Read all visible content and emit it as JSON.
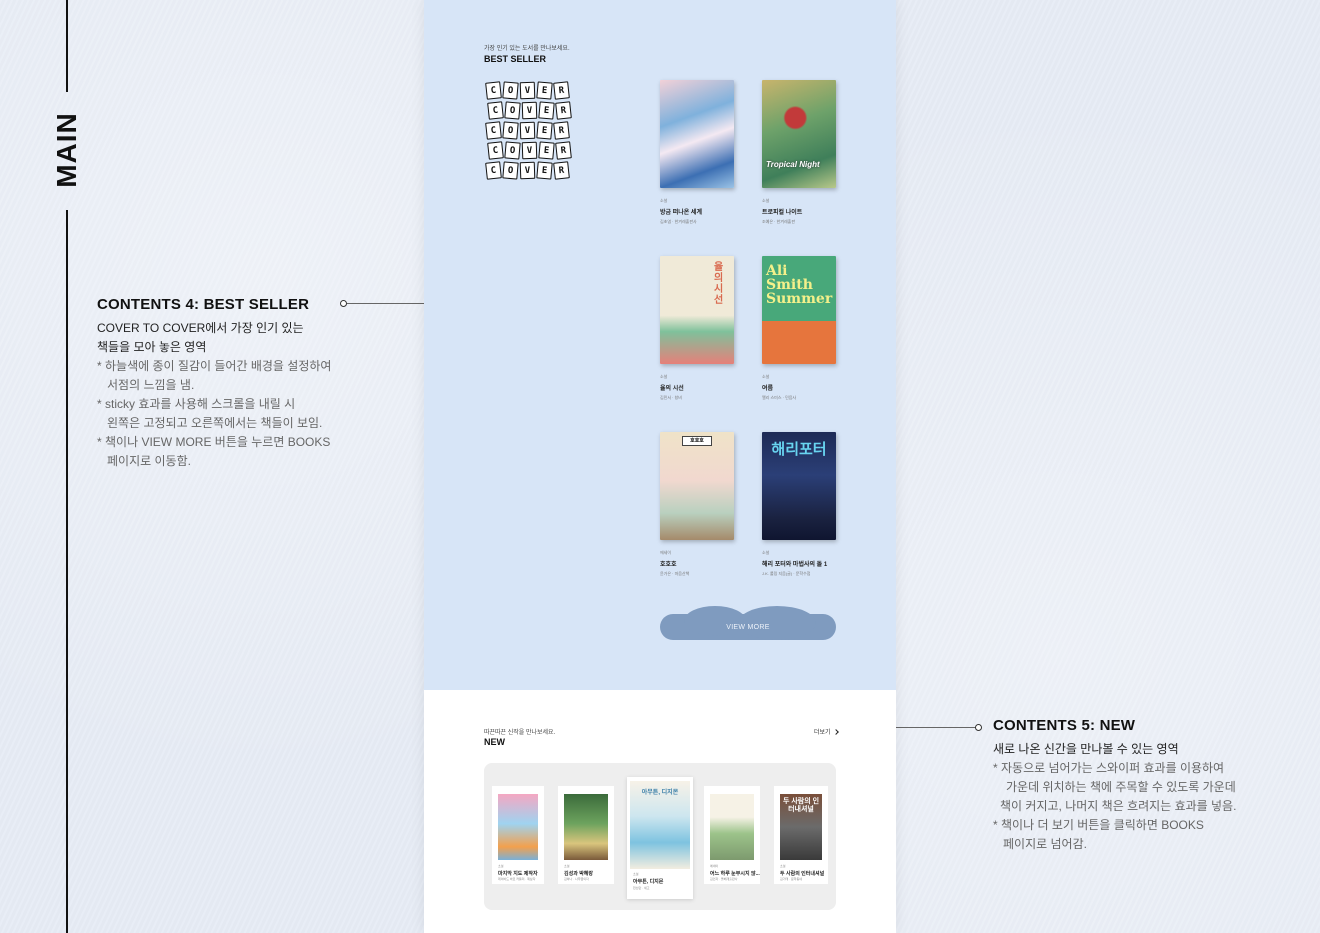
{
  "side_label": "MAIN",
  "annotation_best": {
    "title": "CONTENTS 4:  BEST SELLER",
    "lines": [
      "COVER TO COVER에서 가장 인기 있는",
      "책들을 모아 놓은 영역"
    ],
    "notes": [
      "* 하늘색에 종이 질감이 들어간 배경을 설정하여",
      "서점의 느낌을 냄.",
      "* sticky 효과를 사용해 스크롤을 내릴 시",
      "왼쪽은 고정되고 오른쪽에서는 책들이 보임.",
      "* 책이나 VIEW MORE 버튼을 누르면 BOOKS",
      "페이지로 이동함."
    ]
  },
  "annotation_new": {
    "title": "CONTENTS 5: NEW",
    "lines": [
      "새로 나온 신간을 만나볼 수 있는 영역"
    ],
    "notes": [
      "* 자동으로 넘어가는 스와이퍼 효과를 이용하여",
      "가운데 위치하는 책에 주목할 수 있도록 가운데",
      "책이 커지고, 나머지 책은 흐려지는 효과를 넣음.",
      "* 책이나 더 보기 버튼을 클릭하면 BOOKS",
      "페이지로 넘어감."
    ]
  },
  "best_seller": {
    "subtitle": "가장 인기 있는 도서를 만나보세요.",
    "title": "BEST SELLER",
    "logo_rows": [
      "COVER",
      "COVER",
      "COVER",
      "COVER",
      "COVER"
    ],
    "books": [
      {
        "category": "소설",
        "title": "방금 떠나온 세계",
        "author": "김초엽 · 한겨레출판사",
        "cover_text": ""
      },
      {
        "category": "소설",
        "title": "트로피컬 나이트",
        "author": "조예은 · 한겨레출판",
        "cover_text": "Tropical Night"
      },
      {
        "category": "소설",
        "title": "율의 시선",
        "author": "김민서 · 창비",
        "cover_text": "율의 시선"
      },
      {
        "category": "소설",
        "title": "여름",
        "author": "앨리 스미스 · 민음사",
        "cover_text": "Ali Smith Summer"
      },
      {
        "category": "에세이",
        "title": "호호호",
        "author": "윤가은 · 마음산책",
        "cover_text": "호호호"
      },
      {
        "category": "소설",
        "title": "해리 포터와 마법사의 돌 1",
        "author": "J.K. 롤링 지음(글) · 문학수첩",
        "cover_text": "해리포터"
      }
    ],
    "view_more": "VIEW MORE"
  },
  "new_section": {
    "subtitle": "따끈따끈 신작을 만나보세요.",
    "title": "NEW",
    "more_label": "더보기",
    "books": [
      {
        "category": "소설",
        "title": "마지막 지도 제작자",
        "author": "데이비드 바르 커틀리 · 제삼자",
        "cover_text": ""
      },
      {
        "category": "소설",
        "title": "김성과 박혜랑",
        "author": "김하나 · 나무옆의자",
        "cover_text": ""
      },
      {
        "category": "소설",
        "title": "아무튼, 디지몬",
        "author": "천선란 · 세고",
        "cover_text": "아무튼, 디지몬"
      },
      {
        "category": "에세이",
        "title": "어느 하루 눈부시지 않...",
        "author": "김인자 · 돌베개출판사",
        "cover_text": ""
      },
      {
        "category": "소설",
        "title": "두 사람의 인터내셔널",
        "author": "김기태 · 문학동네",
        "cover_text": "두 사람의 인터내셔널"
      }
    ]
  }
}
